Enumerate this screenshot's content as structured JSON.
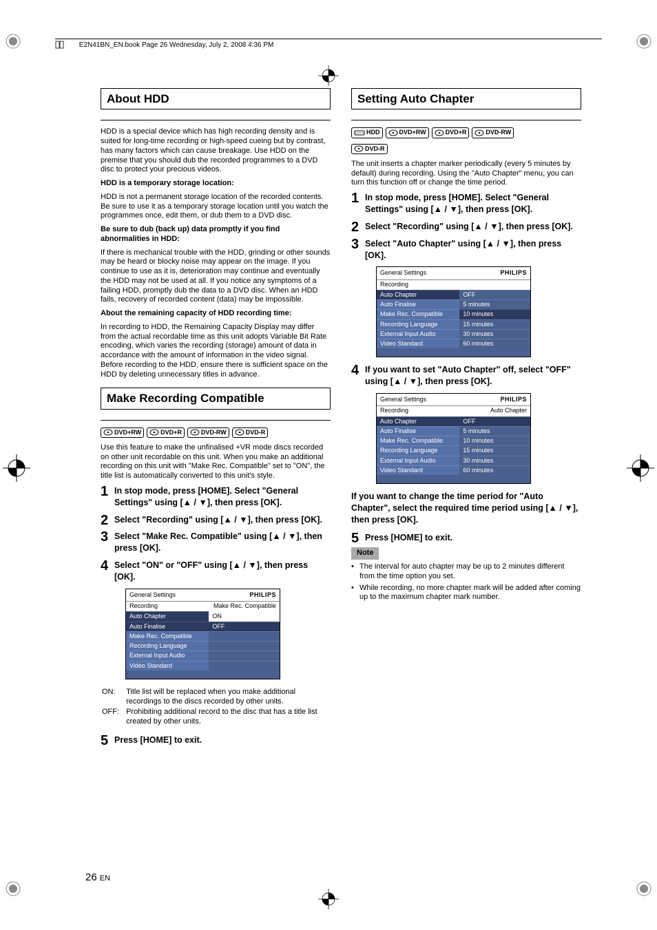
{
  "header": "E2N41BN_EN.book  Page 26  Wednesday, July 2, 2008  4:36 PM",
  "page_number": "26",
  "page_lang": "EN",
  "left": {
    "h1": "About HDD",
    "p1": "HDD is a special device which has high recording density and is suited for long-time recording or high-speed cueing but by contrast, has many factors which can cause breakage. Use HDD on the premise that you should dub the recorded programmes to a DVD disc to protect your precious videos.",
    "b1": "HDD is a temporary storage location:",
    "p2": "HDD is not a permanent storage location of the recorded contents. Be sure to use it as a temporary storage location until you watch the programmes once, edit them, or dub them to a DVD disc.",
    "b2": "Be sure to dub (back up) data promptly if you find abnormalities in HDD:",
    "p3": "If there is mechanical trouble with the HDD, grinding or other sounds may be heard or blocky noise may appear on the image. If you continue to use as it is, deterioration may continue and eventually the HDD may not be used at all. If you notice any symptoms of a failing HDD, promptly dub the data to a DVD disc. When an HDD fails, recovery of recorded content (data) may be impossible.",
    "b3": "About the remaining capacity of HDD recording time:",
    "p4": "In recording to HDD, the Remaining Capacity Display may differ from the actual recordable time as this unit adopts Variable Bit Rate encoding, which varies the recording (storage) amount of data in accordance with the amount of information in the video signal. Before recording to the HDD, ensure there is sufficient space on the HDD by deleting unnecessary titles in advance.",
    "h2": "Make Recording Compatible",
    "badges": [
      "DVD+RW",
      "DVD+R",
      "DVD-RW",
      "DVD-R"
    ],
    "p5": "Use this feature to make the unfinalised +VR mode discs recorded on other unit recordable on this unit. When you make an additional recording on this unit with \"Make Rec. Compatible\" set to \"ON\", the title list is automatically converted to this unit's style.",
    "steps": [
      "In stop mode, press [HOME]. Select \"General Settings\" using [▲ / ▼], then press [OK].",
      "Select \"Recording\" using [▲ / ▼], then press [OK].",
      "Select \"Make Rec. Compatible\" using [▲ / ▼], then press [OK].",
      "Select \"ON\" or \"OFF\" using [▲ / ▼], then press [OK]."
    ],
    "menu": {
      "title": "General Settings",
      "brand": "PHILIPS",
      "sub": "Recording",
      "sub_right": "Make Rec. Compatible",
      "left_rows": [
        "Auto Chapter",
        "Auto Finalise",
        "Make Rec. Compatible",
        "Recording Language",
        "External Input Audio",
        "Video Standard"
      ],
      "right_rows": [
        "ON",
        "OFF",
        "",
        "",
        "",
        ""
      ]
    },
    "on_label": "ON:",
    "on_text": "Title list will be replaced when you make additional recordings to the discs recorded by other units.",
    "off_label": "OFF:",
    "off_text": "Prohibiting additional record to the disc that has a title list created by other units.",
    "step5": "Press [HOME] to exit."
  },
  "right": {
    "h1": "Setting Auto Chapter",
    "badges_row1": [
      "HDD",
      "DVD+RW",
      "DVD+R",
      "DVD-RW"
    ],
    "badges_row2": [
      "DVD-R"
    ],
    "p1": "The unit inserts a chapter marker periodically (every 5 minutes by default) during recording. Using the \"Auto Chapter\" menu, you can turn this function off or change the time period.",
    "steps123": [
      "In stop mode, press [HOME]. Select \"General Settings\" using [▲ / ▼], then press [OK].",
      "Select \"Recording\" using [▲ / ▼], then press [OK].",
      "Select \"Auto Chapter\" using [▲ / ▼], then press [OK]."
    ],
    "menu1": {
      "title": "General Settings",
      "brand": "PHILIPS",
      "sub": "Recording",
      "left_rows": [
        "Auto Chapter",
        "Auto Finalise",
        "Make Rec. Compatible",
        "Recording Language",
        "External Input Audio",
        "Video Standard"
      ],
      "right_rows": [
        "OFF",
        "5 minutes",
        "10 minutes",
        "15 minutes",
        "30 minutes",
        "60 minutes"
      ],
      "hl_left_idx": 0,
      "hl_right_idx": 2
    },
    "step4": "If you want to set \"Auto Chapter\" off, select \"OFF\" using [▲ / ▼], then press [OK].",
    "menu2": {
      "title": "General Settings",
      "brand": "PHILIPS",
      "sub": "Recording",
      "sub_right": "Auto Chapter",
      "left_rows": [
        "Auto Chapter",
        "Auto Finalise",
        "Make Rec. Compatible",
        "Recording Language",
        "External Input Audio",
        "Video Standard"
      ],
      "right_rows": [
        "OFF",
        "5 minutes",
        "10 minutes",
        "15 minutes",
        "30 minutes",
        "60 minutes"
      ],
      "hl_left_idx": 0,
      "hl_right_idx": 0
    },
    "para_change": "If you want to change the time period for \"Auto Chapter\", select the required time period using [▲ / ▼], then press [OK].",
    "step5": "Press [HOME] to exit.",
    "note_label": "Note",
    "notes": [
      "The interval for auto chapter may be up to 2 minutes different from the time option you set.",
      "While recording, no more chapter mark will be added after coming up to the maximum chapter mark number."
    ]
  }
}
